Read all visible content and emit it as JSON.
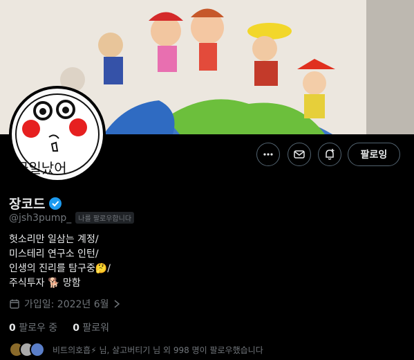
{
  "profile": {
    "display_name": "장코드",
    "handle": "@jsh3pump_",
    "follows_you_badge": "나를 팔로우합니다",
    "avatar_text": "국일났어",
    "bio_lines": [
      "헛소리만 일삼는 계정/",
      "미스테리 연구소 인턴/",
      "인생의 진리를 탐구중🤔/",
      "주식투자 🐕 망함"
    ],
    "joined": "가입일: 2022년 6월",
    "following_count": "0",
    "following_label": "팔로우 중",
    "followers_count": "0",
    "followers_label": "팔로워",
    "known_followers_text": "비트의호흡⚡ 님, 살고버티기 님 외 998 명이 팔로우했습니다"
  },
  "actions": {
    "more_icon": "more-horizontal-icon",
    "message_icon": "envelope-icon",
    "notify_icon": "bell-plus-icon",
    "follow_label": "팔로잉"
  },
  "colors": {
    "background": "#000000",
    "text": "#e7e9ea",
    "muted": "#71767b",
    "verified": "#1d9bf0",
    "border": "#536471"
  }
}
